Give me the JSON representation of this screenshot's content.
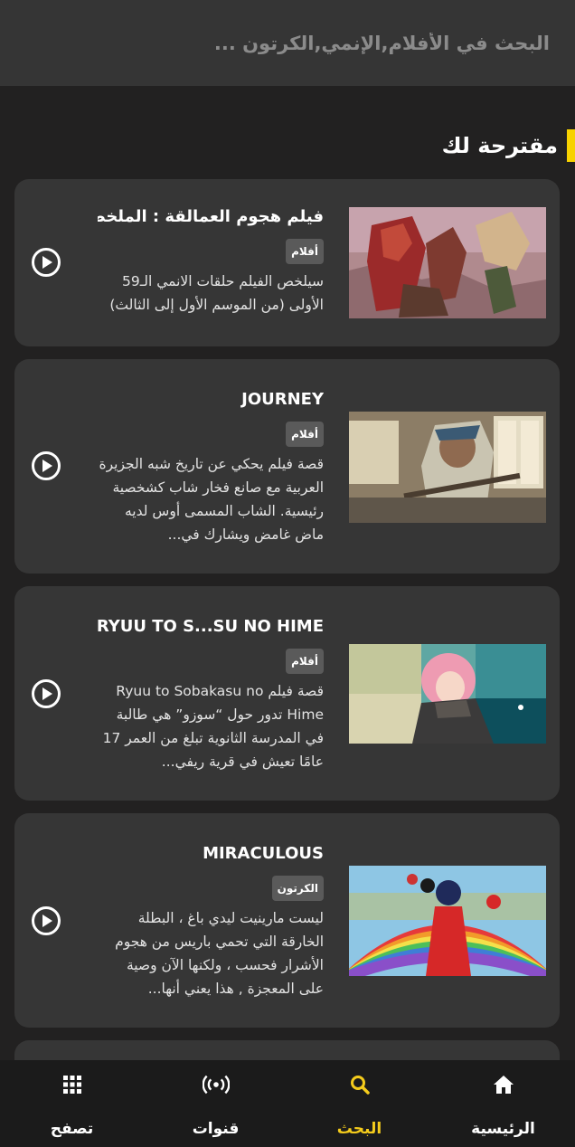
{
  "search": {
    "placeholder": "البحث في الأفلام,الإنمي,الكرتون ..."
  },
  "section": {
    "title": "مقترحة لك",
    "accent_color": "#f7d200"
  },
  "cards": [
    {
      "title": "فيلم هجوم العمالقة : الملخص",
      "badge": "أفلام",
      "description": "سيلخص الفيلم حلقات الانمي الـ59 الأولى (من الموسم الأول إلى الثالث)",
      "thumbnail": "attack-on-titan-thumbnail"
    },
    {
      "title": "JOURNEY",
      "badge": "أفلام",
      "description": "قصة فيلم يحكي عن تاريخ شبه الجزيرة العربية مع صانع فخار شاب كشخصية رئيسية. الشاب المسمى أوس لديه ماض غامض ويشارك في...",
      "thumbnail": "journey-thumbnail"
    },
    {
      "title": "RYUU TO S...SU NO HIME",
      "badge": "أفلام",
      "description": "قصة فيلم Ryuu to Sobakasu no Hime تدور حول “سوزو” هي طالبة في المدرسة الثانوية تبلغ من العمر 17 عامًا تعيش في قرية ريفي...",
      "thumbnail": "belle-thumbnail"
    },
    {
      "title": "MIRACULOUS",
      "badge": "الكرتون",
      "description": "ليست مارينيت ليدي باغ ، البطلة الخارقة التي تحمي باريس من هجوم الأشرار فحسب ، ولكنها الآن وصية على المعجزة , هذا يعني أنها...",
      "thumbnail": "miraculous-thumbnail"
    }
  ],
  "nav": {
    "items": [
      {
        "label": "الرئيسية",
        "icon": "home-icon"
      },
      {
        "label": "البحث",
        "icon": "search-icon",
        "active": true
      },
      {
        "label": "قنوات",
        "icon": "broadcast-icon"
      },
      {
        "label": "تصفح",
        "icon": "grid-icon"
      }
    ],
    "active_color": "#f5cc1c"
  }
}
